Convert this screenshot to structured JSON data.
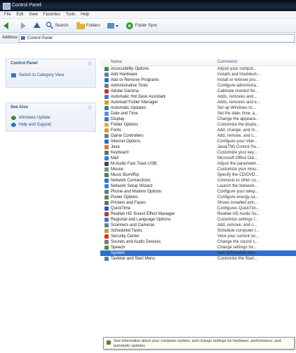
{
  "window": {
    "title": "Control Panel"
  },
  "menu": [
    "File",
    "Edit",
    "View",
    "Favorites",
    "Tools",
    "Help"
  ],
  "toolbar": {
    "search_label": "Search",
    "folders_label": "Folders",
    "folder_sync_label": "Folder Sync"
  },
  "address": {
    "label": "Address",
    "value": "Control Panel"
  },
  "sidebar": {
    "control_panel_header": "Control Panel",
    "switch_label": "Switch to Category View",
    "see_also_header": "See Also",
    "links": [
      "Windows Update",
      "Help and Support"
    ]
  },
  "columns": {
    "name": "Name",
    "comments": "Comments"
  },
  "items": [
    {
      "name": "Accessibility Options",
      "comment": "Adjust your comput..."
    },
    {
      "name": "Add Hardware",
      "comment": "Installs and troublesh..."
    },
    {
      "name": "Add or Remove Programs",
      "comment": "Install or remove pro..."
    },
    {
      "name": "Administrative Tools",
      "comment": "Configure administra..."
    },
    {
      "name": "Adobe Gamma",
      "comment": "Calibrate monitor for..."
    },
    {
      "name": "Automatic Hot Desk Assistant",
      "comment": "Adds, removes and..."
    },
    {
      "name": "Autoload Folder Manager",
      "comment": "Adds, removes and e..."
    },
    {
      "name": "Automatic Updates",
      "comment": "Set up Windows to..."
    },
    {
      "name": "Date and Time",
      "comment": "Set the date, time, a..."
    },
    {
      "name": "Display",
      "comment": "Change the appeara..."
    },
    {
      "name": "Folder Options",
      "comment": "Customize the displa..."
    },
    {
      "name": "Fonts",
      "comment": "Add, change, and m..."
    },
    {
      "name": "Game Controllers",
      "comment": "Add, remove, and c..."
    },
    {
      "name": "Internet Options",
      "comment": "Configure your Inter..."
    },
    {
      "name": "Java",
      "comment": "Java(TM) Control Pa..."
    },
    {
      "name": "Keyboard",
      "comment": "Customize your key..."
    },
    {
      "name": "Mail",
      "comment": "Microsoft Office Out..."
    },
    {
      "name": "M-Audio Fast Track USB",
      "comment": "Adjust the parameter..."
    },
    {
      "name": "Mouse",
      "comment": "Customize your mou..."
    },
    {
      "name": "Music Burn/Rip",
      "comment": "Specify the CD/DVD..."
    },
    {
      "name": "Network Connections",
      "comment": "Connects to other co..."
    },
    {
      "name": "Network Setup Wizard",
      "comment": "Launch the Network..."
    },
    {
      "name": "Phone and Modem Options",
      "comment": "Configure your telep..."
    },
    {
      "name": "Power Options",
      "comment": "Configure energy-sa..."
    },
    {
      "name": "Printers and Faxes",
      "comment": "Shows installed prin..."
    },
    {
      "name": "QuickTime",
      "comment": "Configures QuickTim..."
    },
    {
      "name": "Realtek HD Sound Effect Manager",
      "comment": "Realtek HD Audio So..."
    },
    {
      "name": "Regional and Language Options",
      "comment": "Customize settings f..."
    },
    {
      "name": "Scanners and Cameras",
      "comment": "Add, remove, and c..."
    },
    {
      "name": "Scheduled Tasks",
      "comment": "Schedule computer t..."
    },
    {
      "name": "Security Center",
      "comment": "View your current se..."
    },
    {
      "name": "Sounds and Audio Devices",
      "comment": "Change the sound s..."
    },
    {
      "name": "Speech",
      "comment": "Change settings for..."
    },
    {
      "name": "System",
      "comment": "See information abo..."
    },
    {
      "name": "Taskbar and Start Menu",
      "comment": "Customize the Start..."
    }
  ],
  "tooltip": "See information about your computer system, and change settings for hardware, performance, and automatic updates.",
  "icon_colors": [
    "#3f8a3a",
    "#5b7fb5",
    "#2d6fbf",
    "#6d7d8e",
    "#c0392b",
    "#4a78c2",
    "#d4a017",
    "#2c7bd0",
    "#5a8fd1",
    "#3c77c9",
    "#e2b23a",
    "#c8a040",
    "#6b7c8f",
    "#1f6fd0",
    "#e07b24",
    "#5b6f86",
    "#3a7bd5",
    "#444444",
    "#7a8a9c",
    "#3d8b3d",
    "#2f6fd1",
    "#3d7fd0",
    "#6a7a8a",
    "#3a9a3a",
    "#6d6d6d",
    "#1f63c4",
    "#c0392b",
    "#3c7ac9",
    "#5f7f9f",
    "#d49a2a",
    "#c0392b",
    "#7a7a7a",
    "#3a9a3a",
    "#2f6fd1",
    "#4a78c2"
  ]
}
